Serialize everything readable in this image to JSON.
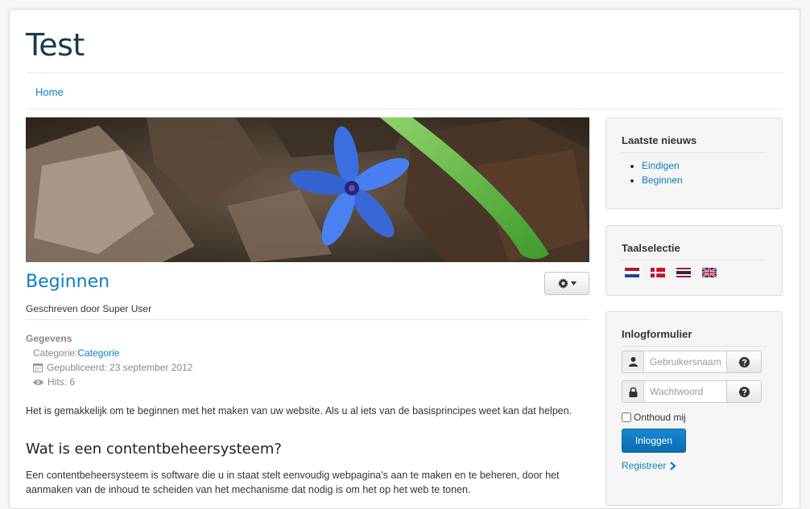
{
  "site": {
    "title": "Test"
  },
  "nav": {
    "home": "Home"
  },
  "article": {
    "title": "Beginnen",
    "byline": "Geschreven door Super User",
    "details_title": "Gegevens",
    "category_label": "Categorie: ",
    "category_value": "Categorie",
    "published": "Gepubliceerd: 23 september 2012",
    "hits": "Hits: 6",
    "intro": "Het is gemakkelijk om te beginnen met het maken van uw website. Als u al iets van de basisprincipes weet kan dat helpen.",
    "heading": "Wat is een contentbeheersysteem?",
    "body": "Een contentbeheersysteem is software die u in staat stelt eenvoudig webpagina's aan te maken en te beheren, door het aanmaken van de inhoud te scheiden van het mechanisme dat nodig is om het op het web te tonen."
  },
  "latest_news": {
    "title": "Laatste nieuws",
    "items": [
      {
        "label": "Eindigen"
      },
      {
        "label": "Beginnen"
      }
    ]
  },
  "language": {
    "title": "Taalselectie",
    "flags": [
      "nl-flag-icon",
      "dk-flag-icon",
      "th-flag-icon",
      "gb-flag-icon"
    ]
  },
  "login": {
    "title": "Inlogformulier",
    "username_placeholder": "Gebruikersnaam",
    "password_placeholder": "Wachtwoord",
    "remember_label": "Onthoud mij",
    "submit_label": "Inloggen",
    "register_label": "Registreer"
  },
  "colors": {
    "link": "#0b7fbd",
    "title": "#1a3a4c",
    "button": "#0b6bb0"
  }
}
